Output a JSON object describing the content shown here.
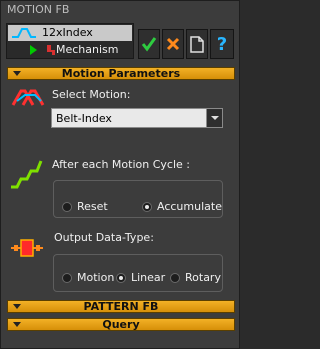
{
  "window": {
    "title": "MOTION FB"
  },
  "tree": {
    "item1": "12xIndex",
    "item2": "Mechanism"
  },
  "toolbar": {
    "buttons": [
      "check-icon",
      "close-icon",
      "document-icon",
      "help-icon"
    ],
    "help_glyph": "?"
  },
  "sections": {
    "motion_parameters": "Motion Parameters",
    "pattern_fb": "PATTERN FB",
    "query": "Query"
  },
  "motion": {
    "select_label": "Select Motion:",
    "selected": "Belt-Index"
  },
  "cycle": {
    "label": "After each Motion Cycle :",
    "options": [
      "Reset",
      "Accumulate"
    ],
    "selected": "Accumulate"
  },
  "output": {
    "label": "Output Data-Type:",
    "options": [
      "Motion",
      "Linear",
      "Rotary"
    ],
    "selected": "Linear"
  },
  "colors": {
    "accent_bar": "#f3b126",
    "check": "#2ecc40",
    "cross": "#ff8a1c",
    "motion_icon": "#ff3030",
    "cycle_icon": "#7fe000",
    "output_icon": "#ff8a1c"
  }
}
